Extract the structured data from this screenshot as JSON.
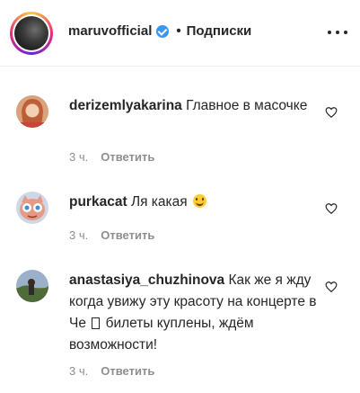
{
  "header": {
    "username": "maruvofficial",
    "separator": "•",
    "follow_label": "Подписки"
  },
  "comments": [
    {
      "username": "derizemlyakarina",
      "text": "Главное в масочке",
      "time": "3 ч.",
      "reply_label": "Ответить"
    },
    {
      "username": "purkacat",
      "text": "Ля какая",
      "emoji": "smiling-face",
      "time": "3 ч.",
      "reply_label": "Ответить"
    },
    {
      "username": "anastasiya_chuzhinova",
      "text_before_glyph": "Как же я жду когда увижу эту красоту на концерте в Че",
      "text_after_glyph": "билеты куплены, ждём возможности!",
      "time": "3 ч.",
      "reply_label": "Ответить"
    }
  ],
  "icons": {
    "verified": "verified-badge-icon",
    "more": "more-options-icon",
    "heart": "heart-outline-icon"
  },
  "colors": {
    "verified": "#3897f0",
    "meta_text": "#8e8e8e",
    "text": "#262626"
  }
}
